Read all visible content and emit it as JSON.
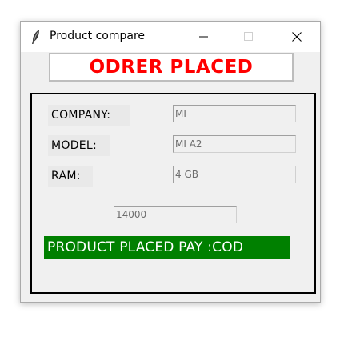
{
  "window": {
    "title": "Product compare",
    "icon": "feather-icon",
    "controls": {
      "minimize": "minimize-icon",
      "maximize": "maximize-icon",
      "close": "close-icon"
    }
  },
  "header": {
    "text": "ODRER PLACED",
    "color": "#ff0000"
  },
  "fields": [
    {
      "label": "COMPANY:",
      "value": "MI"
    },
    {
      "label": "MODEL:",
      "value": "MI A2"
    },
    {
      "label": "RAM:",
      "value": "4 GB"
    }
  ],
  "price": {
    "value": "14000"
  },
  "status": {
    "text": "PRODUCT PLACED PAY :COD",
    "background": "#008000",
    "color": "#ffffff"
  }
}
